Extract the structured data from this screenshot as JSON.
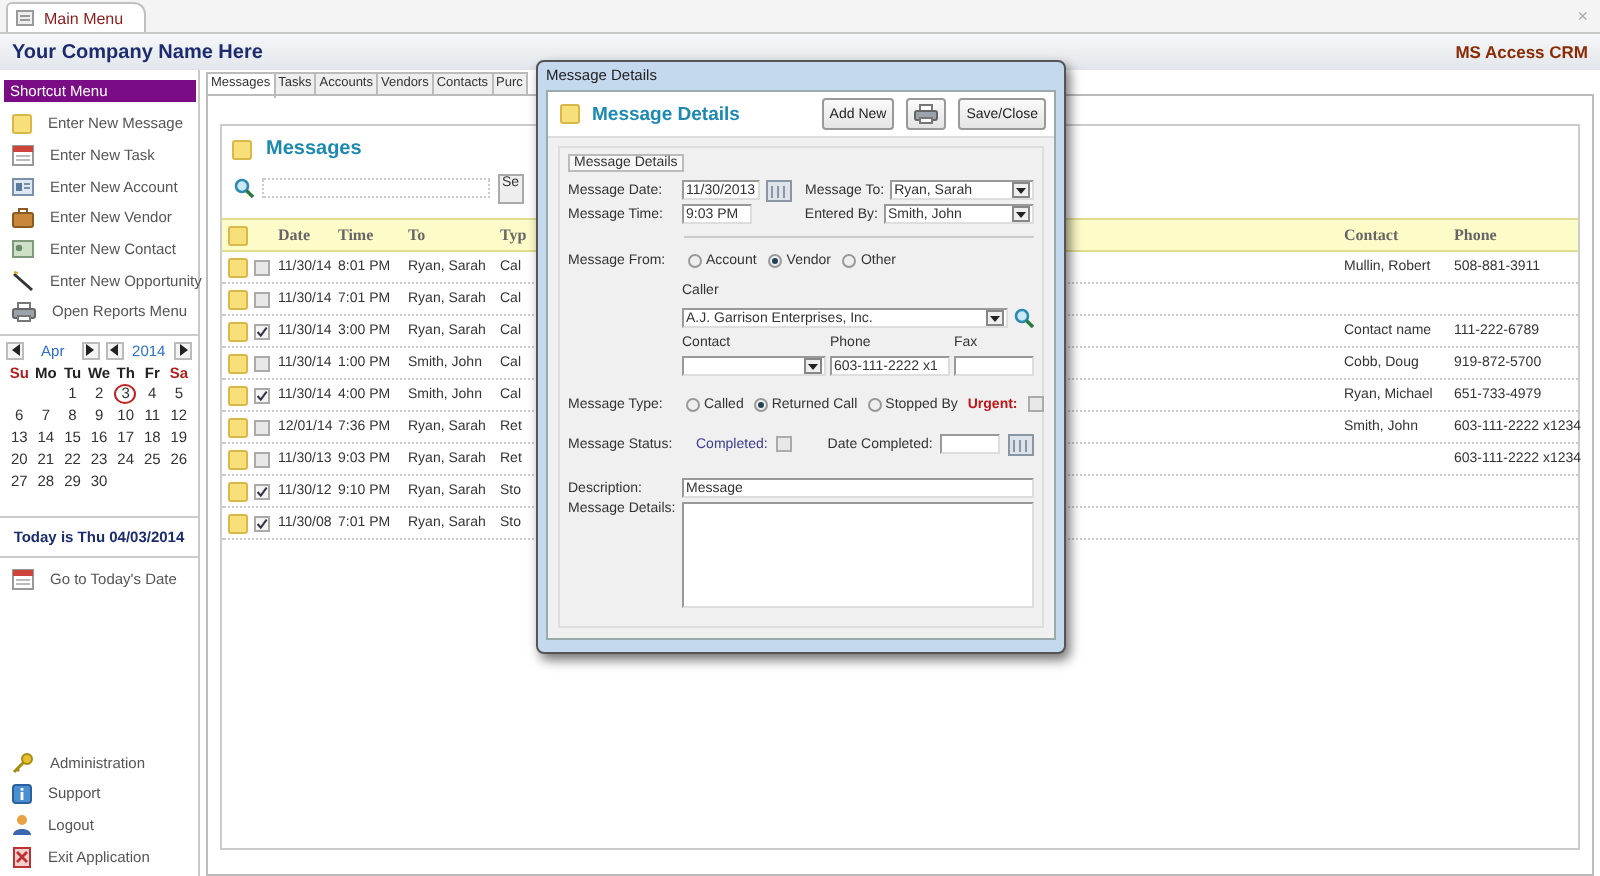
{
  "window": {
    "tab": "Main Menu",
    "close": "×"
  },
  "header": {
    "company": "Your Company Name Here",
    "app": "MS Access CRM"
  },
  "sidebar": {
    "title": "Shortcut Menu",
    "items": [
      "Enter New Message",
      "Enter New Task",
      "Enter New Account",
      "Enter New Vendor",
      "Enter New Contact",
      "Enter New Opportunity",
      "Open Reports Menu"
    ],
    "calendar": {
      "month": "Apr",
      "year": "2014",
      "weekdays": [
        "Su",
        "Mo",
        "Tu",
        "We",
        "Th",
        "Fr",
        "Sa"
      ],
      "weeks": [
        [
          {
            "d": "1",
            "today": false
          },
          {
            "d": "2",
            "today": false
          },
          {
            "d": "3",
            "today": true
          },
          {
            "d": "4",
            "today": false
          },
          {
            "d": "5",
            "today": false
          }
        ],
        [
          {
            "d": "6",
            "today": false
          },
          {
            "d": "7",
            "today": false
          },
          {
            "d": "8",
            "today": false
          },
          {
            "d": "9",
            "today": false
          },
          {
            "d": "10",
            "today": false
          },
          {
            "d": "11",
            "today": false
          },
          {
            "d": "12",
            "today": false
          }
        ],
        [
          {
            "d": "13",
            "today": false
          },
          {
            "d": "14",
            "today": false
          },
          {
            "d": "15",
            "today": false
          },
          {
            "d": "16",
            "today": false
          },
          {
            "d": "17",
            "today": false
          },
          {
            "d": "18",
            "today": false
          },
          {
            "d": "19",
            "today": false
          }
        ],
        [
          {
            "d": "20",
            "today": false
          },
          {
            "d": "21",
            "today": false
          },
          {
            "d": "22",
            "today": false
          },
          {
            "d": "23",
            "today": false
          },
          {
            "d": "24",
            "today": false
          },
          {
            "d": "25",
            "today": false
          },
          {
            "d": "26",
            "today": false
          }
        ],
        [
          {
            "d": "27",
            "today": false
          },
          {
            "d": "28",
            "today": false
          },
          {
            "d": "29",
            "today": false
          },
          {
            "d": "30",
            "today": false
          }
        ]
      ]
    },
    "today": "Today is Thu 04/03/2014",
    "today_link": "Go to Today's Date",
    "bottom_items": [
      "Administration",
      "Support",
      "Logout",
      "Exit Application"
    ]
  },
  "tabs": [
    {
      "label": "Messages",
      "selected": true
    },
    {
      "label": "Tasks",
      "selected": false
    },
    {
      "label": "Accounts",
      "selected": false
    },
    {
      "label": "Vendors",
      "selected": false
    },
    {
      "label": "Contacts",
      "selected": false
    },
    {
      "label": "Purc",
      "selected": false
    }
  ],
  "messages": {
    "title": "Messages",
    "search_button": "Se",
    "columns": [
      "Date",
      "Time",
      "To",
      "Typ",
      "Contact",
      "Phone"
    ],
    "rows": [
      {
        "checked": false,
        "date": "11/30/14",
        "time": "8:01 PM",
        "to": "Ryan, Sarah",
        "type": "Cal",
        "contact": "Mullin, Robert",
        "phone": "508-881-3911"
      },
      {
        "checked": false,
        "date": "11/30/14",
        "time": "7:01 PM",
        "to": "Ryan, Sarah",
        "type": "Cal"
      },
      {
        "checked": true,
        "date": "11/30/14",
        "time": "3:00 PM",
        "to": "Ryan, Sarah",
        "type": "Cal",
        "contact": "Contact name",
        "phone": "111-222-6789"
      },
      {
        "checked": false,
        "date": "11/30/14",
        "time": "1:00 PM",
        "to": "Smith, John",
        "type": "Cal",
        "contact": "Cobb, Doug",
        "phone": "919-872-5700"
      },
      {
        "checked": true,
        "date": "11/30/14",
        "time": "4:00 PM",
        "to": "Smith, John",
        "type": "Cal",
        "contact": "Ryan, Michael",
        "phone": "651-733-4979"
      },
      {
        "checked": false,
        "date": "12/01/14",
        "time": "7:36 PM",
        "to": "Ryan, Sarah",
        "type": "Ret",
        "contact": "Smith, John",
        "phone": "603-111-2222 x1234"
      },
      {
        "checked": false,
        "date": "11/30/13",
        "time": "9:03 PM",
        "to": "Ryan, Sarah",
        "type": "Ret",
        "phone": "603-111-2222 x1234"
      },
      {
        "checked": true,
        "date": "11/30/12",
        "time": "9:10 PM",
        "to": "Ryan, Sarah",
        "type": "Sto"
      },
      {
        "checked": true,
        "date": "11/30/08",
        "time": "7:01 PM",
        "to": "Ryan, Sarah",
        "type": "Sto"
      }
    ]
  },
  "dialog": {
    "title": "Message Details",
    "heading": "Message Details",
    "add_button": "Add New",
    "save_button": "Save/Close",
    "group_label": "Message Details",
    "message_date": {
      "label": "Message Date:",
      "value": "11/30/2013"
    },
    "message_to": {
      "label": "Message To:",
      "value": "Ryan, Sarah"
    },
    "message_time": {
      "label": "Message Time:",
      "value": "9:03 PM"
    },
    "entered_by": {
      "label": "Entered By:",
      "value": "Smith, John"
    },
    "message_from": {
      "label": "Message From:",
      "options": [
        {
          "label": "Account",
          "selected": false
        },
        {
          "label": "Vendor",
          "selected": true
        },
        {
          "label": "Other",
          "selected": false
        }
      ]
    },
    "caller": {
      "label": "Caller",
      "value": "A.J. Garrison Enterprises, Inc."
    },
    "contact": {
      "label": "Contact"
    },
    "phone": {
      "label": "Phone",
      "value": "603-111-2222 x1"
    },
    "fax": {
      "label": "Fax"
    },
    "message_type": {
      "label": "Message Type:",
      "options": [
        {
          "label": "Called",
          "selected": false
        },
        {
          "label": "Returned Call",
          "selected": true
        },
        {
          "label": "Stopped By",
          "selected": false
        }
      ]
    },
    "urgent": {
      "label": "Urgent:",
      "checked": false
    },
    "status": {
      "label": "Message Status:"
    },
    "completed": {
      "label": "Completed:",
      "checked": false
    },
    "date_completed": {
      "label": "Date Completed:"
    },
    "description": {
      "label": "Description:",
      "value": "Message"
    },
    "details": {
      "label": "Message Details:"
    }
  }
}
